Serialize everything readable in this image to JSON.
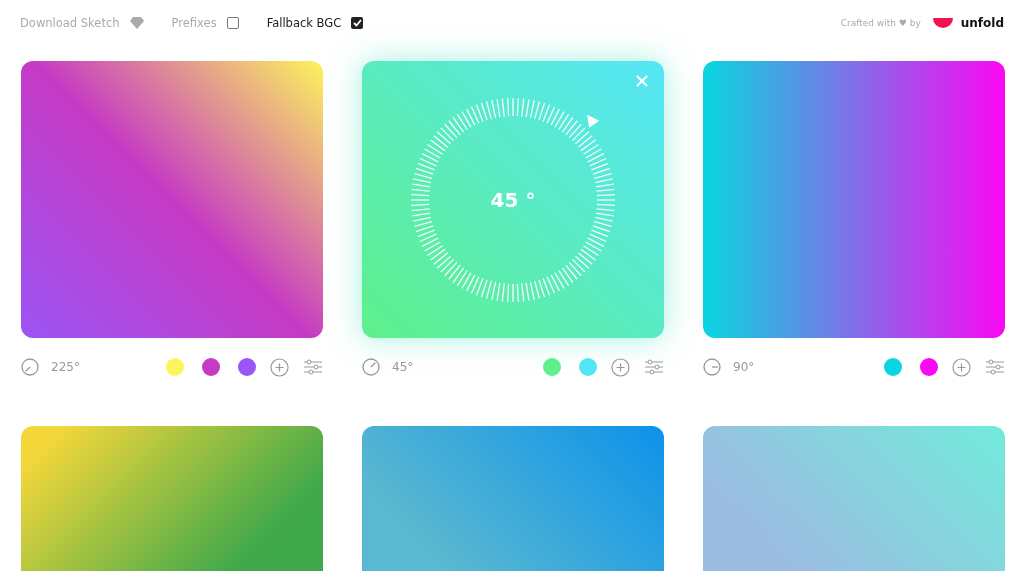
{
  "toolbar": {
    "download": {
      "label": "Download Sketch"
    },
    "prefixes": {
      "label": "Prefixes",
      "checked": false
    },
    "fallback": {
      "label": "Fallback BGC",
      "checked": true
    },
    "credit": {
      "text": "Crafted with ♥ by",
      "brand": "unfold"
    }
  },
  "cards": [
    {
      "angle": "225°",
      "editing": false,
      "colors": [
        {
          "color": "#fdf45c"
        },
        {
          "color": "#c63ac4"
        },
        {
          "color": "#9b55f5"
        }
      ]
    },
    {
      "angle": "45°",
      "editing": true,
      "dial_reading": "45 °",
      "colors": [
        {
          "color": "#5ff08a"
        },
        {
          "color": "#55e6f8"
        }
      ]
    },
    {
      "angle": "90°",
      "editing": false,
      "colors": [
        {
          "color": "#08d6e0"
        },
        {
          "color": "#fa08f2"
        }
      ]
    },
    {
      "kind": "falling",
      "colors": [
        {
          "color": "#f2d63a"
        },
        {
          "color": "#3ea84a"
        }
      ]
    },
    {
      "kind": "rising",
      "colors": [
        {
          "color": "#5ab8d0"
        },
        {
          "color": "#0c92ea"
        }
      ]
    },
    {
      "kind": "rising",
      "colors": [
        {
          "color": "#9cbce2"
        },
        {
          "color": "#72eada"
        }
      ]
    }
  ]
}
